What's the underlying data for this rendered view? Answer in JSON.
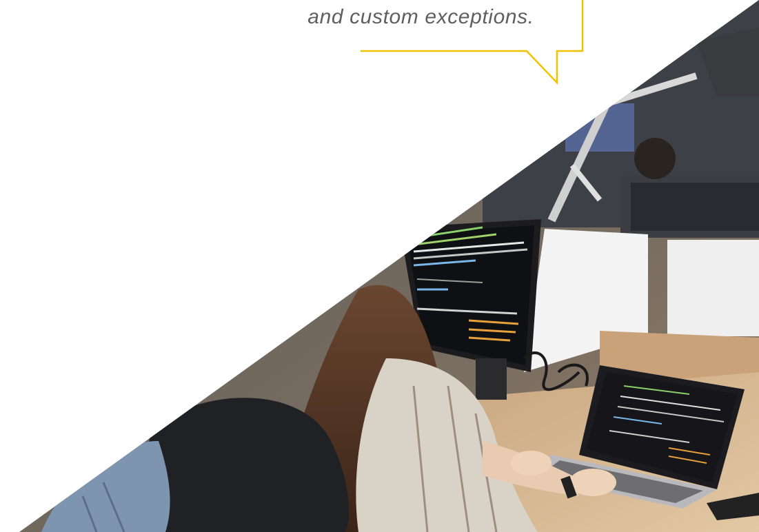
{
  "quote": {
    "text": "and custom exceptions."
  },
  "colors": {
    "accent": "#f2c200",
    "text": "#5f5f5f",
    "background": "#ffffff"
  },
  "photo": {
    "subject": "developers-at-desks-with-code-on-screens",
    "icon": "office-photo"
  }
}
